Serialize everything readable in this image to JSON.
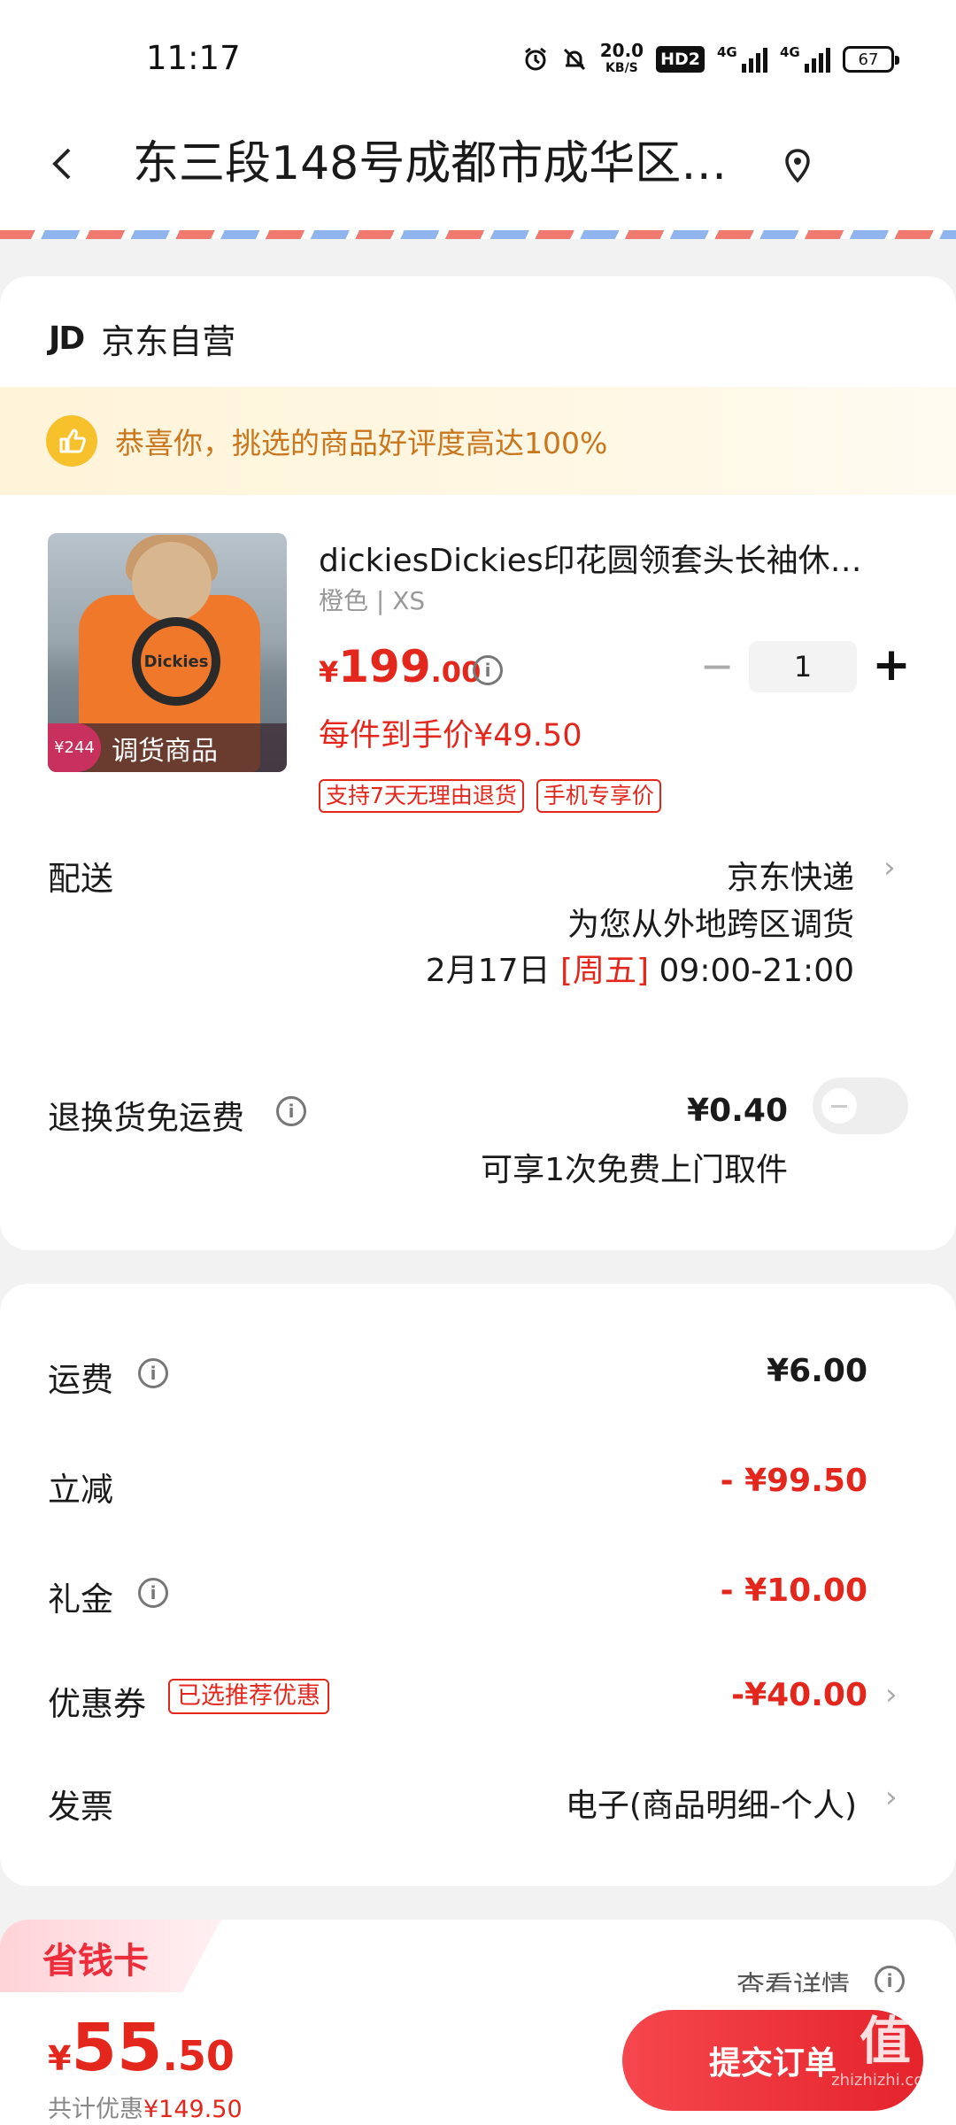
{
  "status": {
    "time": "11:17",
    "net_speed": "20.0",
    "net_unit": "KB/S",
    "hd": "HD2",
    "sig1": "4G",
    "sig2": "4G",
    "battery": "67"
  },
  "header": {
    "address": "东三段148号成都市成华区…"
  },
  "shop": {
    "logo": "JD",
    "name": "京东自营"
  },
  "praise": {
    "text": "恭喜你，挑选的商品好评度高达100%"
  },
  "product": {
    "image_badge_price": "¥244",
    "image_badge_tag": "调货商品",
    "image_logo_text": "Dickies",
    "title": "dickiesDickies印花圆领套头长袖休…",
    "spec": "橙色 | XS",
    "price_currency": "¥",
    "price_int": "199",
    "price_dec": ".00",
    "quantity": "1",
    "unit_price": "每件到手价¥49.50",
    "tags": [
      "支持7天无理由退货",
      "手机专享价"
    ]
  },
  "delivery": {
    "label": "配送",
    "method": "京东快递",
    "note": "为您从外地跨区调货",
    "date": "2月17日",
    "weekday": "[周五]",
    "time": "09:00-21:00"
  },
  "return_insurance": {
    "label": "退换货免运费",
    "price": "¥0.40",
    "note": "可享1次免费上门取件",
    "enabled": false
  },
  "fees": {
    "shipping_label": "运费",
    "shipping_value": "¥6.00",
    "discount_label": "立减",
    "discount_value": "- ¥99.50",
    "gift_label": "礼金",
    "gift_value": "- ¥10.00",
    "coupon_label": "优惠券",
    "coupon_tag": "已选推荐优惠",
    "coupon_value": "-¥40.00",
    "invoice_label": "发票",
    "invoice_value": "电子(商品明细-个人)"
  },
  "saver_card": {
    "title": "省钱卡",
    "detail": "查看详情"
  },
  "footer": {
    "total_currency": "¥",
    "total_int": "55",
    "total_dec": ".50",
    "discount_label": "共计优惠",
    "discount_amount": "¥149.50",
    "submit_label": "提交订单",
    "watermark": "值",
    "watermark_sub": "zhizhizhi.com"
  },
  "colors": {
    "accent_red": "#e4271d",
    "button_red": "#e5232b",
    "praise_orange": "#c9761d"
  }
}
